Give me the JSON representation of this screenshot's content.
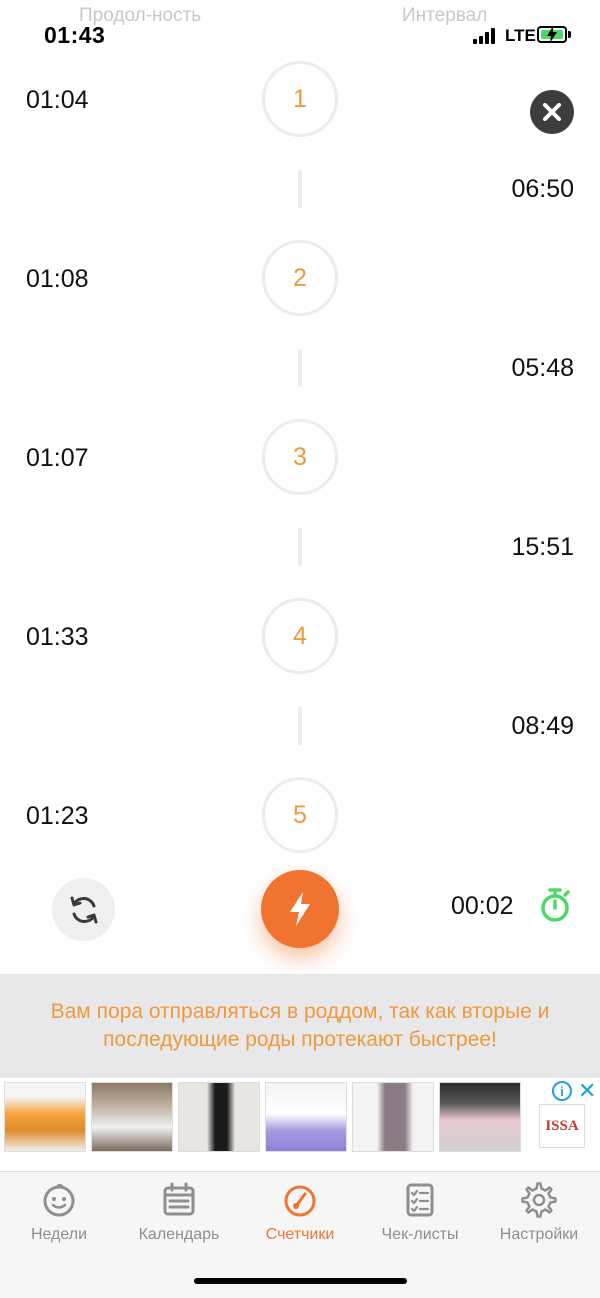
{
  "status_bar": {
    "time": "01:43",
    "network": "LTE"
  },
  "columns": {
    "duration": "Продол-ность",
    "interval": "Интервал"
  },
  "contractions": [
    {
      "number": "1",
      "duration": "01:04"
    },
    {
      "number": "2",
      "duration": "01:08"
    },
    {
      "number": "3",
      "duration": "01:07"
    },
    {
      "number": "4",
      "duration": "01:33"
    },
    {
      "number": "5",
      "duration": "01:23"
    }
  ],
  "intervals": [
    "06:50",
    "05:48",
    "15:51",
    "08:49"
  ],
  "controls": {
    "timer": "00:02"
  },
  "banner": {
    "text": "Вам пора отправляться в роддом, так как вторые и последующие роды протекают быстрее!"
  },
  "ad": {
    "brand": "ISSA",
    "info_icon": "i",
    "close_icon": "✕"
  },
  "tabs": [
    {
      "label": "Недели",
      "icon": "baby-face-icon"
    },
    {
      "label": "Календарь",
      "icon": "calendar-icon"
    },
    {
      "label": "Счетчики",
      "icon": "gauge-icon",
      "active": true
    },
    {
      "label": "Чек-листы",
      "icon": "checklist-icon"
    },
    {
      "label": "Настройки",
      "icon": "gear-icon"
    }
  ],
  "colors": {
    "accent": "#f07430",
    "number": "#f0993a",
    "stopwatch": "#4cd964",
    "tab_inactive": "#8e8e93"
  }
}
